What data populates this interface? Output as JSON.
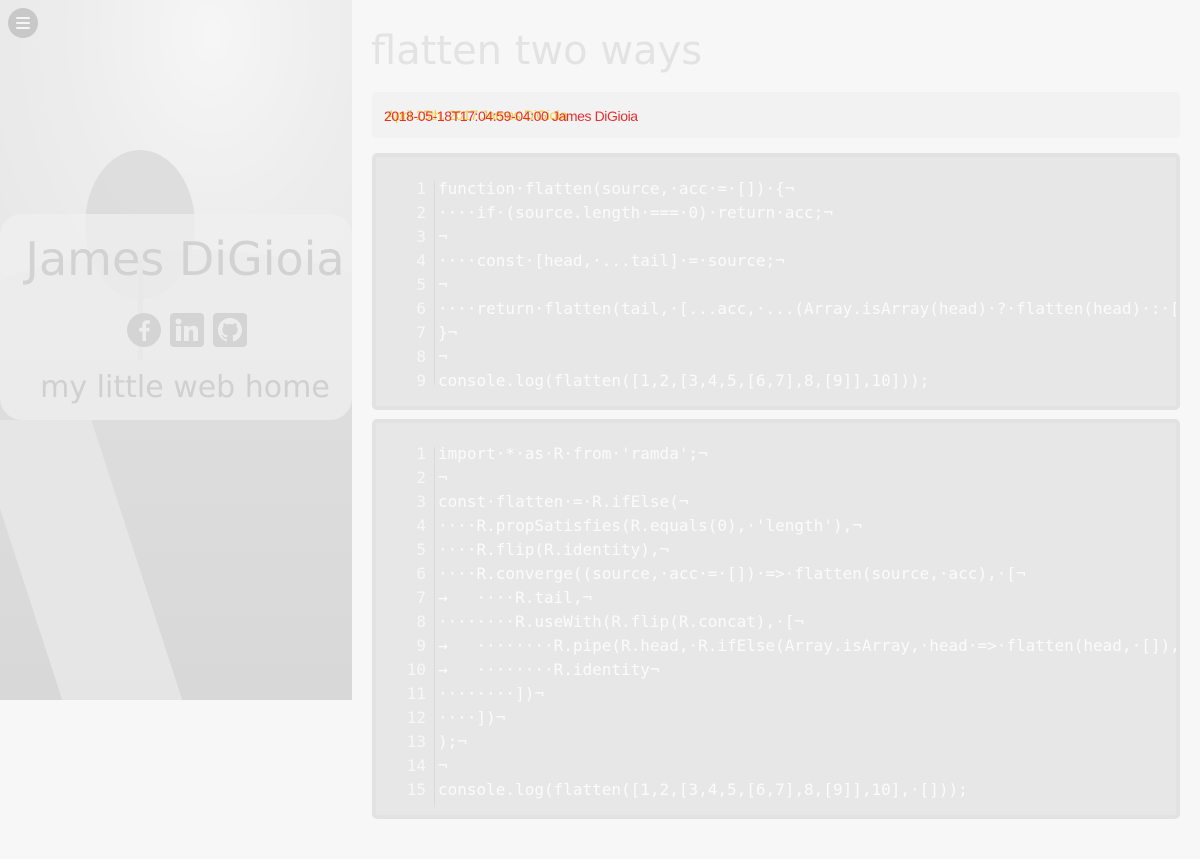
{
  "sidebar": {
    "author_name": "James DiGioia",
    "tagline": "my little web home",
    "menu_icon": "hamburger-menu-icon",
    "social": [
      {
        "name": "facebook-icon",
        "label": "f"
      },
      {
        "name": "linkedin-icon",
        "label": "in"
      },
      {
        "name": "github-icon",
        "label": "github"
      }
    ]
  },
  "post": {
    "title": "flatten two ways",
    "meta_primary": "2018-05-18T17:04:59-04:00 James DiGioia",
    "meta_overlap": "April 15th, 2017 James DiGioia"
  },
  "code_blocks": [
    {
      "lines": [
        {
          "n": "1",
          "code": "function·flatten(source,·acc·=·[])·{¬"
        },
        {
          "n": "2",
          "code": "····if·(source.length·===·0)·return·acc;¬"
        },
        {
          "n": "3",
          "code": "¬"
        },
        {
          "n": "4",
          "code": "····const·[head,·...tail]·=·source;¬"
        },
        {
          "n": "5",
          "code": "¬"
        },
        {
          "n": "6",
          "code": "····return·flatten(tail,·[...acc,·...(Array.isArray(head)·?·flatten(head)·:·[head])]);¬"
        },
        {
          "n": "7",
          "code": "}¬"
        },
        {
          "n": "8",
          "code": "¬"
        },
        {
          "n": "9",
          "code": "console.log(flatten([1,2,[3,4,5,[6,7],8,[9]],10]));"
        }
      ]
    },
    {
      "lines": [
        {
          "n": "1",
          "code": "import·*·as·R·from·'ramda';¬"
        },
        {
          "n": "2",
          "code": "¬"
        },
        {
          "n": "3",
          "code": "const·flatten·=·R.ifElse(¬"
        },
        {
          "n": "4",
          "code": "····R.propSatisfies(R.equals(0),·'length'),¬"
        },
        {
          "n": "5",
          "code": "····R.flip(R.identity),¬"
        },
        {
          "n": "6",
          "code": "····R.converge((source,·acc·=·[])·=>·flatten(source,·acc),·[¬"
        },
        {
          "n": "7",
          "code": "→   ····R.tail,¬"
        },
        {
          "n": "8",
          "code": "········R.useWith(R.flip(R.concat),·[¬"
        },
        {
          "n": "9",
          "code": "→   ········R.pipe(R.head,·R.ifElse(Array.isArray,·head·=>·flatten(head,·[]),·R.of)),¬"
        },
        {
          "n": "10",
          "code": "→   ········R.identity¬"
        },
        {
          "n": "11",
          "code": "········])¬"
        },
        {
          "n": "12",
          "code": "····])¬"
        },
        {
          "n": "13",
          "code": ");¬"
        },
        {
          "n": "14",
          "code": "¬"
        },
        {
          "n": "15",
          "code": "console.log(flatten([1,2,[3,4,5,[6,7],8,[9]],10],·[]));"
        }
      ]
    }
  ]
}
